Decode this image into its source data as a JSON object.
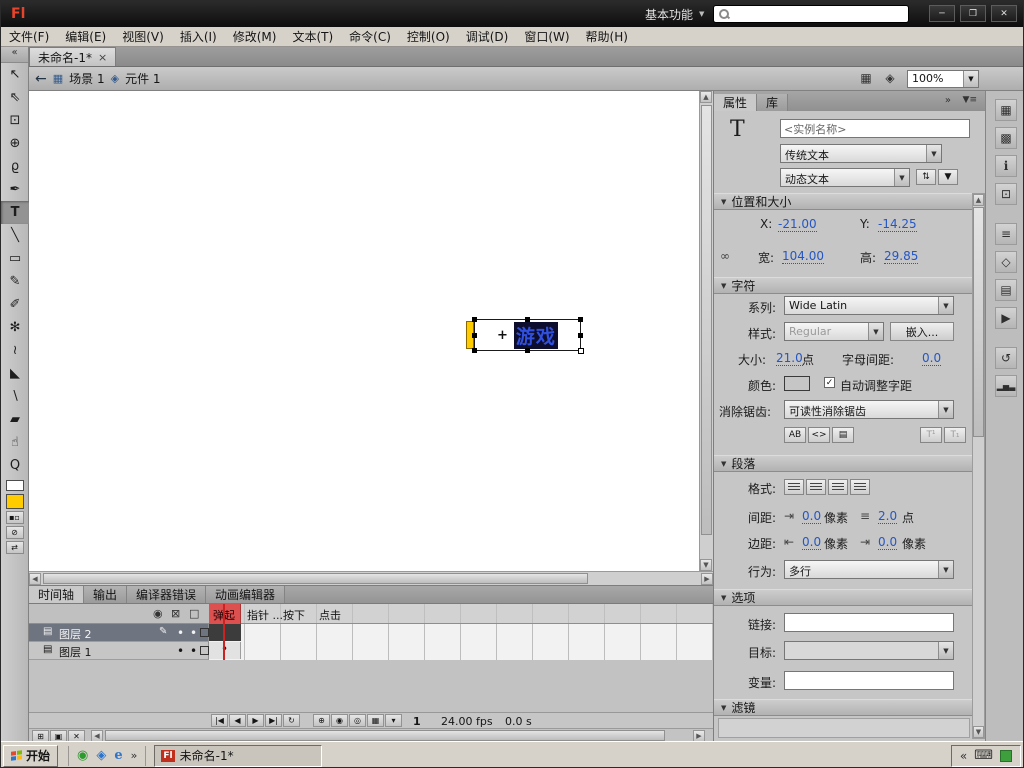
{
  "window": {
    "logo": "Fl",
    "workspace": "基本功能",
    "min": "─",
    "restore": "❐",
    "close": "✕"
  },
  "menubar": [
    "文件(F)",
    "编辑(E)",
    "视图(V)",
    "插入(I)",
    "修改(M)",
    "文本(T)",
    "命令(C)",
    "控制(O)",
    "调试(D)",
    "窗口(W)",
    "帮助(H)"
  ],
  "doctab": {
    "title": "未命名-1*",
    "close": "×"
  },
  "editbar": {
    "back": "←",
    "scene": "场景 1",
    "symbol": "元件 1",
    "zoom": "100%"
  },
  "tools": [
    {
      "name": "selection-tool",
      "glyph": "↖"
    },
    {
      "name": "subselection-tool",
      "glyph": "⇖"
    },
    {
      "name": "free-transform-tool",
      "glyph": "⊡"
    },
    {
      "name": "3d-rotation-tool",
      "glyph": "⊕"
    },
    {
      "name": "lasso-tool",
      "glyph": "ϱ"
    },
    {
      "name": "pen-tool",
      "glyph": "✒"
    },
    {
      "name": "text-tool",
      "glyph": "T"
    },
    {
      "name": "line-tool",
      "glyph": "╲"
    },
    {
      "name": "rectangle-tool",
      "glyph": "▭"
    },
    {
      "name": "pencil-tool",
      "glyph": "✎"
    },
    {
      "name": "brush-tool",
      "glyph": "✐"
    },
    {
      "name": "deco-tool",
      "glyph": "✻"
    },
    {
      "name": "bone-tool",
      "glyph": "≀"
    },
    {
      "name": "paint-bucket-tool",
      "glyph": "◣"
    },
    {
      "name": "eyedropper-tool",
      "glyph": "∖"
    },
    {
      "name": "eraser-tool",
      "glyph": "▰"
    },
    {
      "name": "hand-tool",
      "glyph": "☝"
    },
    {
      "name": "zoom-tool",
      "glyph": "Q"
    }
  ],
  "toolextras": {
    "default_colors": "▪▫",
    "no_color": "⊘",
    "swap_colors": "⇄"
  },
  "swatches": {
    "stroke": "background:#ffffff",
    "fill": "background:#ffcc00",
    "text_color": "background:#ffcc00",
    "layer2": "background:#c45ec4",
    "layer1": "background:#43c343",
    "yellow_bar": "background:#ffcc00"
  },
  "stage": {
    "text": "游戏",
    "registration": "+"
  },
  "props": {
    "tab_properties": "属性",
    "tab_library": "库",
    "instance_name": "<实例名称>",
    "engine": "传统文本",
    "type": "动态文本",
    "pos": {
      "title": "位置和大小",
      "x_label": "X:",
      "x": "-21.00",
      "y_label": "Y:",
      "y": "-14.25",
      "w_label": "宽:",
      "w": "104.00",
      "h_label": "高:",
      "h": "29.85"
    },
    "ch": {
      "title": "字符",
      "family_label": "系列:",
      "family": "Wide Latin",
      "style_label": "样式:",
      "style": "Regular",
      "embed": "嵌入...",
      "size_label": "大小:",
      "size": "21.0",
      "size_unit": "点",
      "tracking_label": "字母间距:",
      "tracking": "0.0",
      "color_label": "颜色:",
      "auto_kern": "自动调整字距",
      "aa_label": "消除锯齿:",
      "aa": "可读性消除锯齿",
      "selectable": "AB",
      "html": "<>",
      "show_border": "▤",
      "superscript": "T¹",
      "subscript": "T₁"
    },
    "para": {
      "title": "段落",
      "format_label": "格式:",
      "spacing_label": "间距:",
      "indent": "0.0",
      "indent_unit": "像素",
      "leading": "2.0",
      "leading_unit": "点",
      "margin_label": "边距:",
      "margin_left": "0.0",
      "ml_unit": "像素",
      "margin_right": "0.0",
      "mr_unit": "像素",
      "behavior_label": "行为:",
      "behavior": "多行"
    },
    "opt": {
      "title": "选项",
      "link_label": "链接:",
      "target_label": "目标:",
      "variable_label": "变量:"
    },
    "filters": {
      "title": "滤镜"
    }
  },
  "timeline": {
    "tabs": [
      "时间轴",
      "输出",
      "编译器错误",
      "动画编辑器"
    ],
    "frames": [
      "弹起",
      "指针 ...",
      "按下",
      "点击"
    ],
    "layers": [
      {
        "name": "图层 2"
      },
      {
        "name": "图层 1"
      }
    ],
    "frame_no": "1",
    "fps": "24.00 fps",
    "time": "0.0 s"
  },
  "taskbar": {
    "start": "开始",
    "chevron": "»",
    "task_logo": "Fl",
    "task": "未命名-1*",
    "tray_chevron": "«"
  },
  "icons": {
    "collapse": "«",
    "caret": "▼",
    "tri": "▼",
    "check": "✓",
    "eye": "◉",
    "lock": "⊠",
    "outline": "□",
    "pencil": "✎",
    "dot": "•",
    "layerdoc": "▤",
    "chain": "∞",
    "textdir": "⇅",
    "clapper": "▦",
    "symbol_icon": "◈",
    "first": "|◀",
    "prev": "◀",
    "play": "▶",
    "next": "▶|",
    "loop": "↻",
    "center_frame": "⊕",
    "onion": "◉",
    "onion_outline": "◎",
    "multi_frame": "▦",
    "markers": "▾",
    "new_layer": "⊞",
    "new_folder": "▣",
    "trash": "✕",
    "up": "▲",
    "down": "▼",
    "left": "◀",
    "right": "▶",
    "panel_expand": "»",
    "panel_menu": "▼≡",
    "indent": "⇥",
    "leading": "≡",
    "margin_left": "⇤",
    "margin_right": "⇥",
    "keyboard": "⌨"
  },
  "strip": [
    {
      "name": "swatches-panel-icon",
      "glyph": "▦"
    },
    {
      "name": "color-panel-icon",
      "glyph": "▩"
    },
    {
      "name": "info-panel-icon",
      "glyph": "i"
    },
    {
      "name": "transform-panel-icon",
      "glyph": "⊡"
    },
    {
      "name": "align-panel-icon",
      "glyph": "≡"
    },
    {
      "name": "code-snippets-panel-icon",
      "glyph": "◇"
    },
    {
      "name": "components-panel-icon",
      "glyph": "▤"
    },
    {
      "name": "motion-presets-panel-icon",
      "glyph": "▶"
    },
    {
      "name": "history-panel-icon",
      "glyph": "↺"
    },
    {
      "name": "stats-panel-icon",
      "glyph": "▂▅▃"
    }
  ]
}
